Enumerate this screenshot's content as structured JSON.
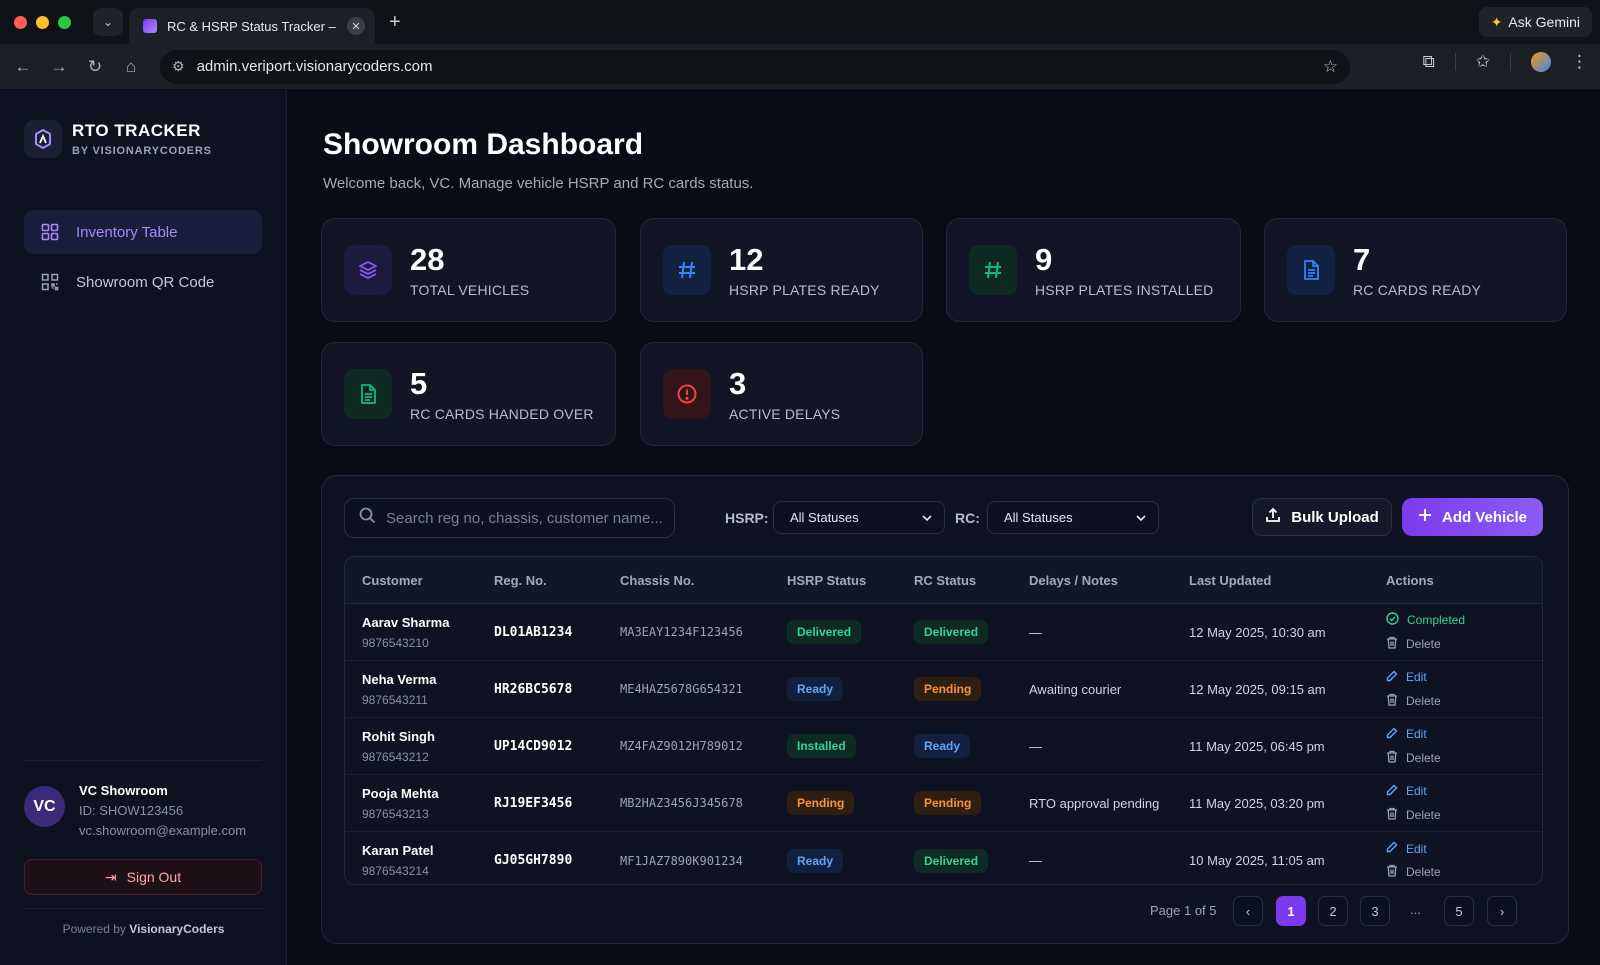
{
  "browser": {
    "tab_title": "RC & HSRP Status Tracker –",
    "url": "admin.veriport.visionarycoders.com",
    "gemini_label": "Ask Gemini"
  },
  "brand": {
    "title": "RTO TRACKER",
    "subtitle": "BY VISIONARYCODERS"
  },
  "nav": [
    {
      "label": "Inventory Table",
      "icon": "grid-icon"
    },
    {
      "label": "Showroom QR Code",
      "icon": "qr-code-icon"
    }
  ],
  "user": {
    "initials": "VC",
    "name": "VC Showroom",
    "id": "ID: SHOW123456",
    "email": "vc.showroom@example.com"
  },
  "signout_label": "Sign Out",
  "powered": {
    "prefix": "Powered by",
    "name": "VisionaryCoders"
  },
  "page": {
    "title": "Showroom Dashboard",
    "subtitle": "Welcome back, VC. Manage vehicle HSRP and RC cards status."
  },
  "stats": [
    {
      "value": "28",
      "label": "TOTAL VEHICLES",
      "icon": "layers-icon",
      "color": "#8b5cf6"
    },
    {
      "value": "12",
      "label": "HSRP PLATES READY",
      "icon": "hash-icon",
      "color": "#3b82f6"
    },
    {
      "value": "9",
      "label": "HSRP PLATES INSTALLED",
      "icon": "hash-icon",
      "color": "#10b981"
    },
    {
      "value": "7",
      "label": "RC CARDS READY",
      "icon": "document-icon",
      "color": "#3b82f6"
    },
    {
      "value": "5",
      "label": "RC CARDS HANDED OVER",
      "icon": "document-icon",
      "color": "#10b981"
    },
    {
      "value": "3",
      "label": "ACTIVE DELAYS",
      "icon": "alert-icon",
      "color": "#ef4444"
    }
  ],
  "filters": {
    "search_placeholder": "Search reg no, chassis, customer name...",
    "hsrp_label": "HSRP:",
    "hsrp_value": "All Statuses",
    "rc_label": "RC:",
    "rc_value": "All Statuses",
    "bulk_label": "Bulk Upload",
    "add_label": "Add Vehicle"
  },
  "table": {
    "headers": [
      "Customer",
      "Reg. No.",
      "Chassis No.",
      "HSRP Status",
      "RC Status",
      "Delays / Notes",
      "Last Updated",
      "Actions"
    ],
    "rows": [
      {
        "name": "Aarav Sharma",
        "phone": "9876543210",
        "reg": "DL01AB1234",
        "chassis": "MA3EAY1234F123456",
        "hsrp": "Delivered",
        "rc": "Delivered",
        "note": "—",
        "updated": "12 May 2025, 10:30 am",
        "action": "Completed",
        "delete": "Delete"
      },
      {
        "name": "Neha Verma",
        "phone": "9876543211",
        "reg": "HR26BC5678",
        "chassis": "ME4HAZ5678G654321",
        "hsrp": "Ready",
        "rc": "Pending",
        "note": "Awaiting courier",
        "updated": "12 May 2025, 09:15 am",
        "action": "Edit",
        "delete": "Delete"
      },
      {
        "name": "Rohit Singh",
        "phone": "9876543212",
        "reg": "UP14CD9012",
        "chassis": "MZ4FAZ9012H789012",
        "hsrp": "Installed",
        "rc": "Ready",
        "note": "—",
        "updated": "11 May 2025, 06:45 pm",
        "action": "Edit",
        "delete": "Delete"
      },
      {
        "name": "Pooja Mehta",
        "phone": "9876543213",
        "reg": "RJ19EF3456",
        "chassis": "MB2HAZ3456J345678",
        "hsrp": "Pending",
        "rc": "Pending",
        "note": "RTO approval pending",
        "updated": "11 May 2025, 03:20 pm",
        "action": "Edit",
        "delete": "Delete"
      },
      {
        "name": "Karan Patel",
        "phone": "9876543214",
        "reg": "GJ05GH7890",
        "chassis": "MF1JAZ7890K901234",
        "hsrp": "Ready",
        "rc": "Delivered",
        "note": "—",
        "updated": "10 May 2025, 11:05 am",
        "action": "Edit",
        "delete": "Delete"
      }
    ]
  },
  "pagination": {
    "text": "Page 1 of 5",
    "pages": [
      "1",
      "2",
      "3",
      "5"
    ],
    "ellipsis": "...",
    "current": "1"
  }
}
